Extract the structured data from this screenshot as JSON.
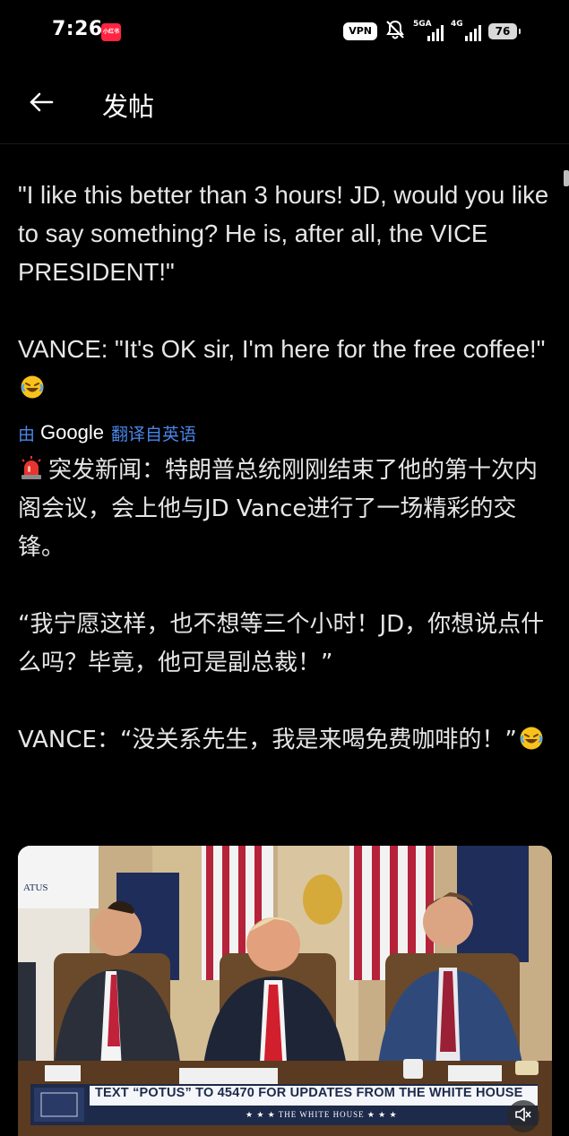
{
  "status_bar": {
    "time": "7:26",
    "app_badge": "小红书",
    "vpn": "VPN",
    "signal1_label": "5GA",
    "signal2_label": "4G",
    "battery": "76"
  },
  "header": {
    "title": "发帖"
  },
  "post": {
    "english_text": "\"I like this better than 3 hours! JD, would you like to say something? He is, after all, the VICE PRESIDENT!\"\n\nVANCE: \"It's OK sir, I'm here for the free coffee!\"",
    "translate_prefix": "由",
    "translate_brand": "Google",
    "translate_suffix": "翻译自英语",
    "chinese_headline": "突发新闻：特朗普总统刚刚结束了他的第十次内阁会议，会上他与JD Vance进行了一场精彩的交锋。",
    "chinese_body": "\n\n“我宁愿这样，也不想等三个小时！JD，你想说点什么吗？毕竟，他可是副总裁！”\n\nVANCE：“没关系先生，我是来喝免费咖啡的！”"
  },
  "video": {
    "banner_text": "TEXT “POTUS” TO 45470 FOR UPDATES FROM THE WHITE HOUSE",
    "banner_sub": "★ ★ ★   THE WHITE HOUSE   ★ ★ ★",
    "seal_text": "ATUS"
  },
  "icons": {
    "back": "arrow-left-icon",
    "mute": "volume-muted-icon",
    "emoji": "rolling-on-floor-laughing-emoji",
    "siren": "police-light-emoji"
  },
  "colors": {
    "background": "#000000",
    "text": "#e6e6e6",
    "translate_link": "#4a86e8",
    "badge_red": "#ff2442"
  }
}
